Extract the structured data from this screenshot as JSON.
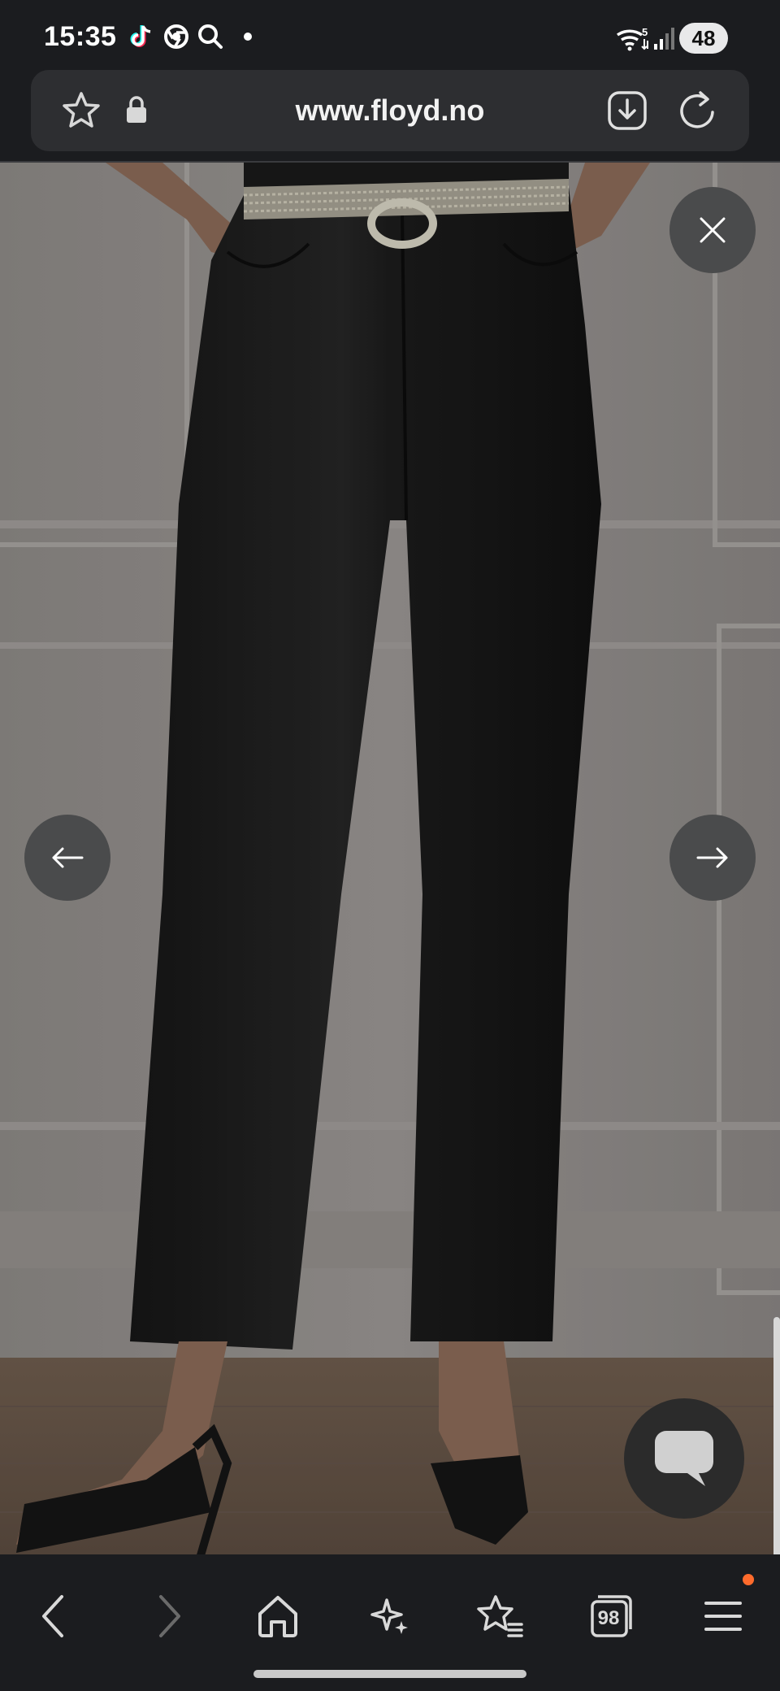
{
  "status_bar": {
    "time": "15:35",
    "app_icons": [
      "tiktok-icon",
      "chrome-icon",
      "search-icon",
      "dot-icon"
    ],
    "network_label": "5",
    "battery": "48"
  },
  "browser": {
    "url": "www.floyd.no",
    "tabs_count": "98"
  },
  "gallery": {
    "image_alt": "Black coated straight-leg jeans with rhinestone belt"
  },
  "bottom_nav": {
    "items": [
      "back-icon",
      "forward-icon",
      "home-icon",
      "sparkle-icon",
      "bookmarks-icon",
      "tabs-icon",
      "menu-icon"
    ]
  },
  "colors": {
    "background": "#1b1c1f",
    "url_bar": "#2d2e31",
    "overlay_button": "#4a4b4c",
    "notification": "#ff6b2c"
  }
}
